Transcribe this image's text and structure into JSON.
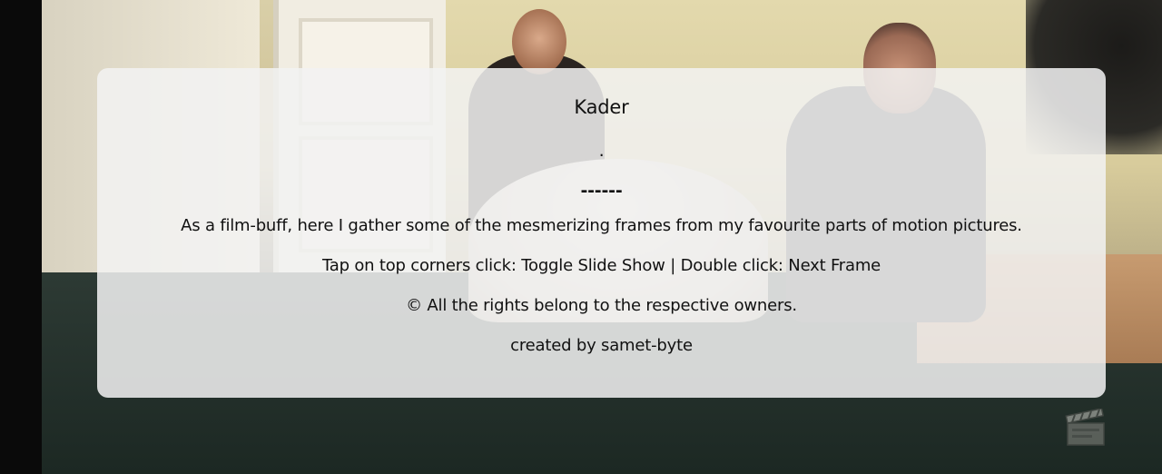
{
  "background": {
    "description_icon": "film-frame-image"
  },
  "card": {
    "title": "Kader",
    "dot": ".",
    "rule": "------",
    "description": "As a film-buff, here I gather some of the mesmerizing frames from my favourite parts of motion pictures.",
    "hint": "Tap on top corners click: Toggle Slide Show | Double click: Next Frame",
    "rights": "© All the rights belong to the respective owners.",
    "credit": "created by samet-byte"
  },
  "icons": {
    "corner_icon": "clapperboard-icon"
  },
  "colors": {
    "card_background": "#f2f2f2",
    "text": "#111111"
  }
}
